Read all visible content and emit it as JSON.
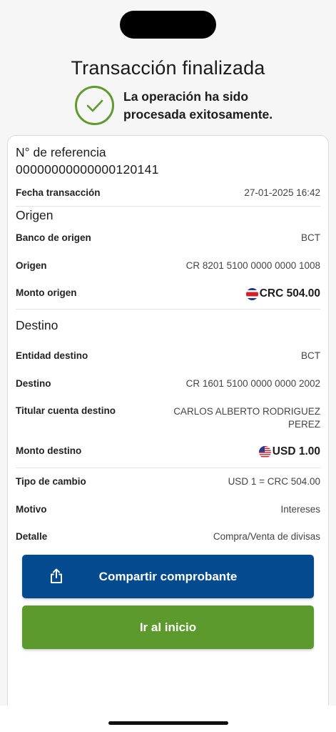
{
  "header": {
    "title": "Transacción finalizada",
    "success_line1": "La operación ha sido",
    "success_line2": "procesada exitosamente."
  },
  "reference": {
    "label": "N° de referencia",
    "value": "00000000000000120141"
  },
  "date": {
    "label": "Fecha transacción",
    "value": "27-01-2025 16:42"
  },
  "origin": {
    "section": "Origen",
    "bank_label": "Banco de origen",
    "bank_value": "BCT",
    "account_label": "Origen",
    "account_value": "CR 8201 5100 0000 0000 1008",
    "amount_label": "Monto origen",
    "amount_value": "CRC 504.00",
    "flag_icon": "costa-rica-flag-icon"
  },
  "destination": {
    "section": "Destino",
    "entity_label": "Entidad destino",
    "entity_value": "BCT",
    "account_label": "Destino",
    "account_value": "CR 1601 5100 0000 0000 2002",
    "holder_label": "Titular cuenta destino",
    "holder_value_line1": "CARLOS ALBERTO RODRIGUEZ",
    "holder_value_line2": "PEREZ",
    "amount_label": "Monto destino",
    "amount_value": "USD 1.00",
    "flag_icon": "usa-flag-icon"
  },
  "extra": {
    "rate_label": "Tipo de cambio",
    "rate_value": "USD 1 = CRC 504.00",
    "reason_label": "Motivo",
    "reason_value": "Intereses",
    "detail_label": "Detalle",
    "detail_value": "Compra/Venta de divisas"
  },
  "buttons": {
    "share_label": "Compartir comprobante",
    "home_label": "Ir al inicio"
  },
  "colors": {
    "primary_blue": "#044a8e",
    "primary_green": "#5d9a2d",
    "success_green": "#5f9a2c"
  }
}
